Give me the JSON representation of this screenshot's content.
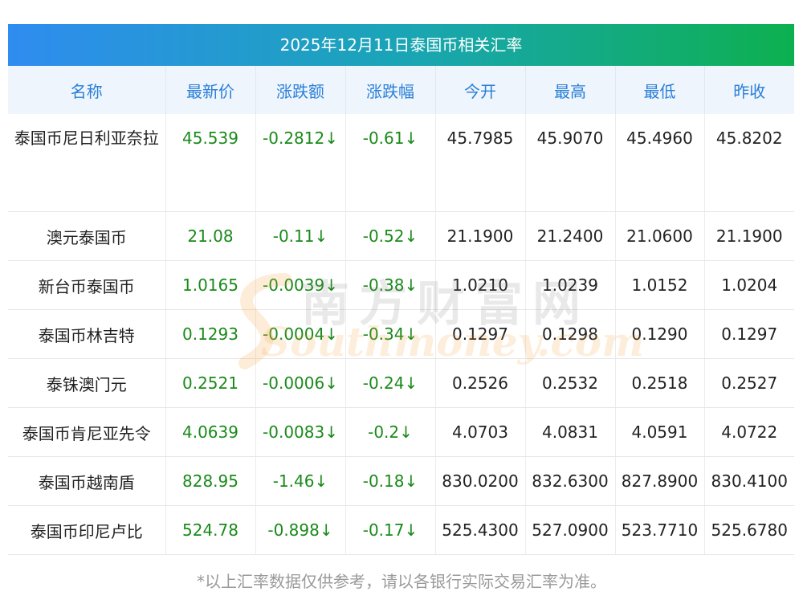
{
  "title": "2025年12月11日泰国币相关汇率",
  "headers": [
    "名称",
    "最新价",
    "涨跌额",
    "涨跌幅",
    "今开",
    "最高",
    "最低",
    "昨收"
  ],
  "rows": [
    {
      "name": "泰国币尼日利亚奈拉",
      "latest": "45.539",
      "change": "-0.2812↓",
      "pct": "-0.61↓",
      "open": "45.7985",
      "high": "45.9070",
      "low": "45.4960",
      "prev": "45.8202"
    },
    {
      "name": "澳元泰国币",
      "latest": "21.08",
      "change": "-0.11↓",
      "pct": "-0.52↓",
      "open": "21.1900",
      "high": "21.2400",
      "low": "21.0600",
      "prev": "21.1900"
    },
    {
      "name": "新台币泰国币",
      "latest": "1.0165",
      "change": "-0.0039↓",
      "pct": "-0.38↓",
      "open": "1.0210",
      "high": "1.0239",
      "low": "1.0152",
      "prev": "1.0204"
    },
    {
      "name": "泰国币林吉特",
      "latest": "0.1293",
      "change": "-0.0004↓",
      "pct": "-0.34↓",
      "open": "0.1297",
      "high": "0.1298",
      "low": "0.1290",
      "prev": "0.1297"
    },
    {
      "name": "泰铢澳门元",
      "latest": "0.2521",
      "change": "-0.0006↓",
      "pct": "-0.24↓",
      "open": "0.2526",
      "high": "0.2532",
      "low": "0.2518",
      "prev": "0.2527"
    },
    {
      "name": "泰国币肯尼亚先令",
      "latest": "4.0639",
      "change": "-0.0083↓",
      "pct": "-0.2↓",
      "open": "4.0703",
      "high": "4.0831",
      "low": "4.0591",
      "prev": "4.0722"
    },
    {
      "name": "泰国币越南盾",
      "latest": "828.95",
      "change": "-1.46↓",
      "pct": "-0.18↓",
      "open": "830.0200",
      "high": "832.6300",
      "low": "827.8900",
      "prev": "830.4100"
    },
    {
      "name": "泰国币印尼卢比",
      "latest": "524.78",
      "change": "-0.898↓",
      "pct": "-0.17↓",
      "open": "525.4300",
      "high": "527.0900",
      "low": "523.7710",
      "prev": "525.6780"
    }
  ],
  "watermark": {
    "cn": "南方财富网",
    "en": "Southmoney.com"
  },
  "footnote": "*以上汇率数据仅供参考，请以各银行实际交易汇率为准。",
  "colors": {
    "header_text": "#2a7fd6",
    "down": "#1a8a1a",
    "title_start": "#2f8cf0",
    "title_end": "#0db04f"
  }
}
